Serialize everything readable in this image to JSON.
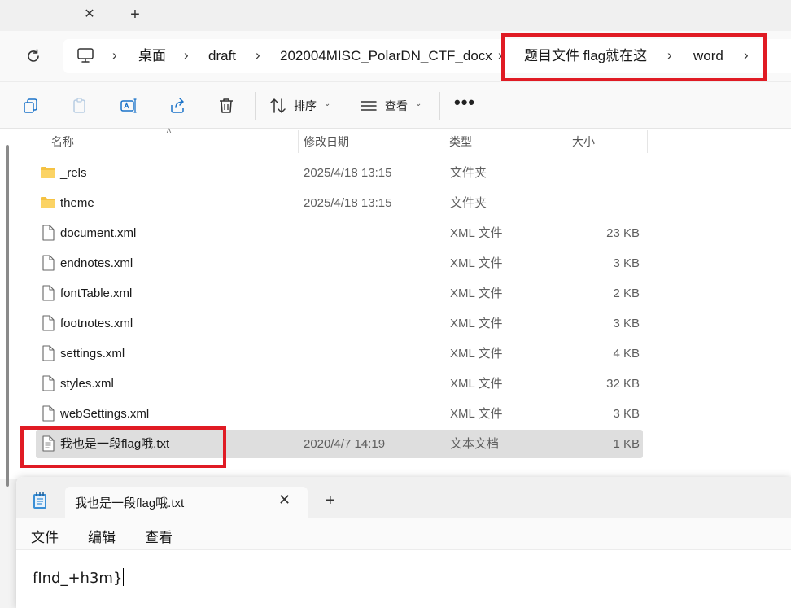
{
  "window": {
    "tab_close": "✕",
    "tab_add": "+"
  },
  "breadcrumb": {
    "separator": "›",
    "items": [
      "桌面",
      "draft",
      "202004MISC_PolarDN_CTF_docx",
      "题目文件 flag就在这",
      "word"
    ]
  },
  "toolbar": {
    "sort_label": "排序",
    "view_label": "查看",
    "more": "•••"
  },
  "columns": {
    "name": "名称",
    "modified": "修改日期",
    "type": "类型",
    "size": "大小"
  },
  "files": [
    {
      "name": "_rels",
      "modified": "2025/4/18 13:15",
      "type": "文件夹",
      "size": "",
      "icon": "folder-icon"
    },
    {
      "name": "theme",
      "modified": "2025/4/18 13:15",
      "type": "文件夹",
      "size": "",
      "icon": "folder-icon"
    },
    {
      "name": "document.xml",
      "modified": "",
      "type": "XML 文件",
      "size": "23 KB",
      "icon": "file-icon"
    },
    {
      "name": "endnotes.xml",
      "modified": "",
      "type": "XML 文件",
      "size": "3 KB",
      "icon": "file-icon"
    },
    {
      "name": "fontTable.xml",
      "modified": "",
      "type": "XML 文件",
      "size": "2 KB",
      "icon": "file-icon"
    },
    {
      "name": "footnotes.xml",
      "modified": "",
      "type": "XML 文件",
      "size": "3 KB",
      "icon": "file-icon"
    },
    {
      "name": "settings.xml",
      "modified": "",
      "type": "XML 文件",
      "size": "4 KB",
      "icon": "file-icon"
    },
    {
      "name": "styles.xml",
      "modified": "",
      "type": "XML 文件",
      "size": "32 KB",
      "icon": "file-icon"
    },
    {
      "name": "webSettings.xml",
      "modified": "",
      "type": "XML 文件",
      "size": "3 KB",
      "icon": "file-icon"
    },
    {
      "name": "我也是一段flag哦.txt",
      "modified": "2020/4/7 14:19",
      "type": "文本文档",
      "size": "1 KB",
      "icon": "text-file-icon",
      "selected": true
    }
  ],
  "notepad": {
    "tab_title": "我也是一段flag哦.txt",
    "tab_close": "✕",
    "tab_add": "+",
    "menu": [
      "文件",
      "编辑",
      "查看"
    ],
    "content": "fInd_+h3m}"
  },
  "colors": {
    "highlight": "#e01b24",
    "selected_row": "#dedede",
    "folder": "#f5c242"
  }
}
